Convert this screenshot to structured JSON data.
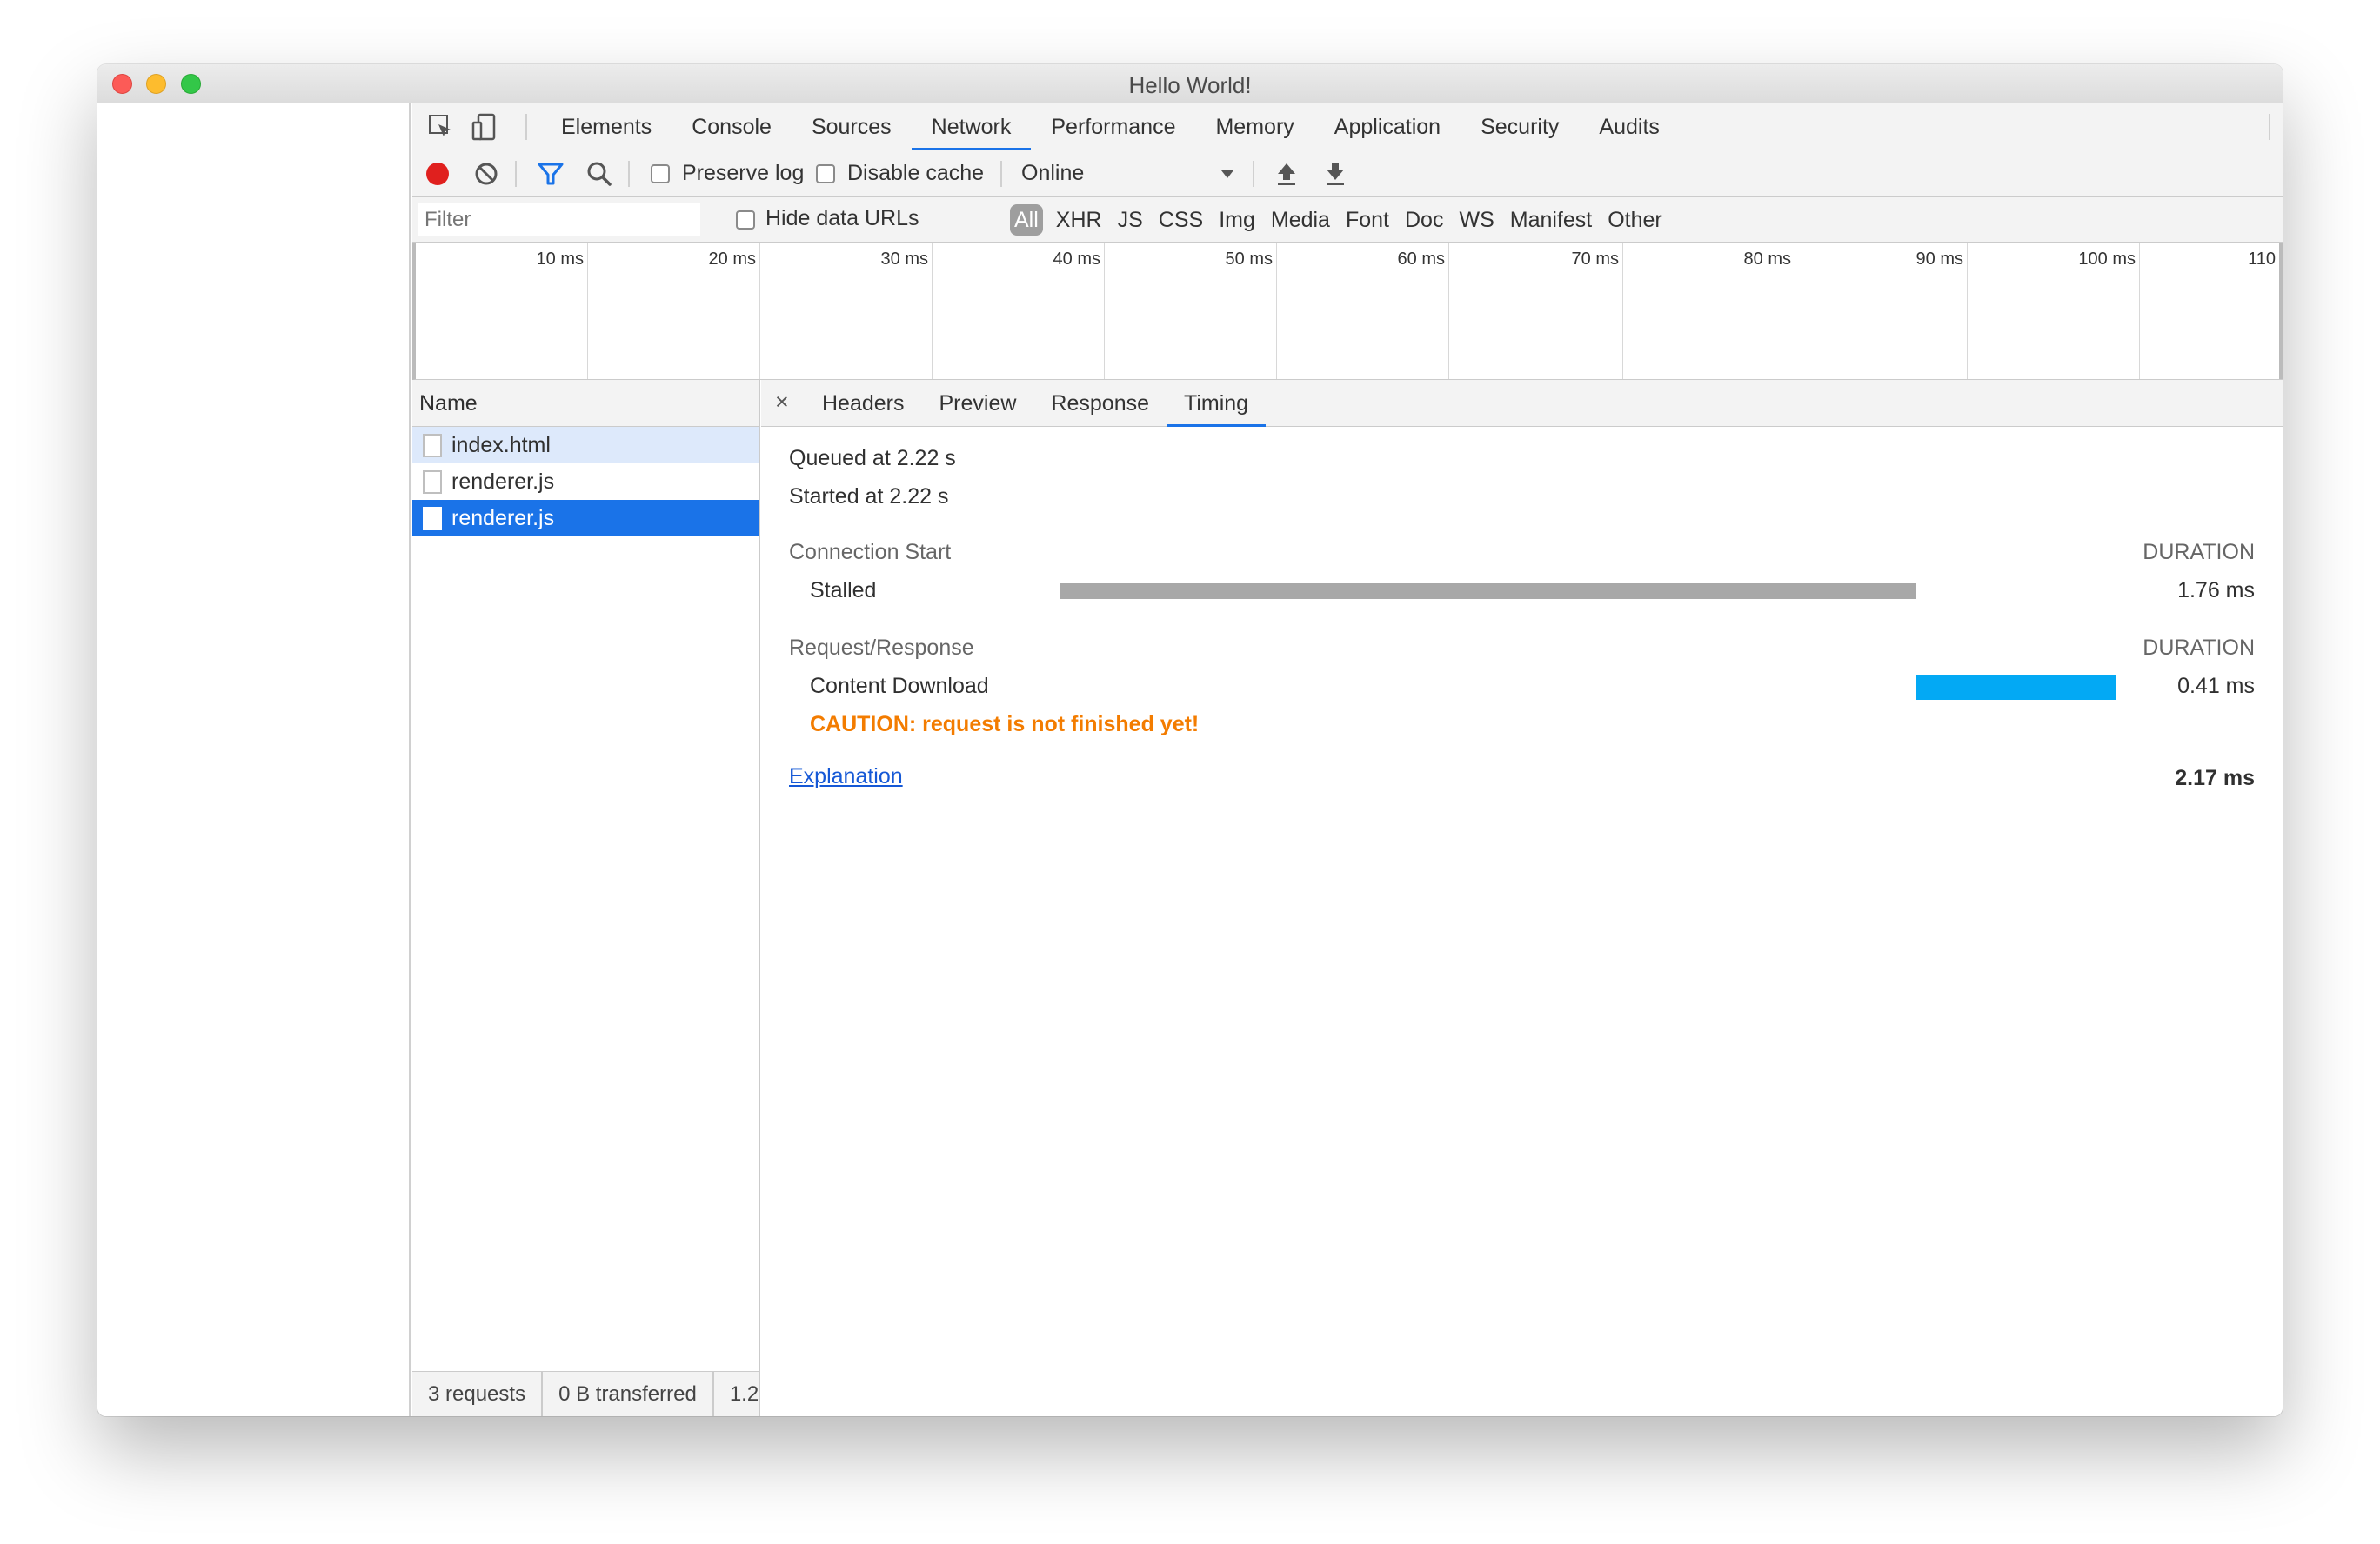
{
  "window": {
    "title": "Hello World!"
  },
  "devtools": {
    "tabs": [
      "Elements",
      "Console",
      "Sources",
      "Network",
      "Performance",
      "Memory",
      "Application",
      "Security",
      "Audits"
    ],
    "active_tab": "Network",
    "toolbar": {
      "preserve_log": "Preserve log",
      "disable_cache": "Disable cache",
      "throttling": "Online"
    },
    "filter": {
      "placeholder": "Filter",
      "hide_data_urls": "Hide data URLs",
      "types": [
        "All",
        "XHR",
        "JS",
        "CSS",
        "Img",
        "Media",
        "Font",
        "Doc",
        "WS",
        "Manifest",
        "Other"
      ],
      "active_type": "All"
    },
    "overview": {
      "ticks": [
        "10 ms",
        "20 ms",
        "30 ms",
        "40 ms",
        "50 ms",
        "60 ms",
        "70 ms",
        "80 ms",
        "90 ms",
        "100 ms",
        "110"
      ]
    },
    "requests": {
      "header": "Name",
      "rows": [
        {
          "name": "index.html"
        },
        {
          "name": "renderer.js"
        },
        {
          "name": "renderer.js"
        }
      ],
      "status": {
        "requests": "3 requests",
        "transferred": "0 B transferred",
        "extra": "1.2"
      }
    },
    "detail": {
      "close": "×",
      "tabs": [
        "Headers",
        "Preview",
        "Response",
        "Timing"
      ],
      "active_tab": "Timing",
      "timing": {
        "queued": "Queued at 2.22 s",
        "started": "Started at 2.22 s",
        "connection_start": {
          "label": "Connection Start",
          "duration_header": "DURATION",
          "stalled_label": "Stalled",
          "stalled_value": "1.76 ms"
        },
        "request_response": {
          "label": "Request/Response",
          "duration_header": "DURATION",
          "download_label": "Content Download",
          "download_value": "0.41 ms",
          "caution": "CAUTION: request is not finished yet!"
        },
        "explanation": "Explanation",
        "total": "2.17 ms"
      }
    }
  },
  "colors": {
    "accent": "#1a73e8",
    "stalled_bar": "#a8a8a8",
    "download_bar": "#03a9f4",
    "caution": "#f37c00",
    "record": "#e0201e"
  }
}
